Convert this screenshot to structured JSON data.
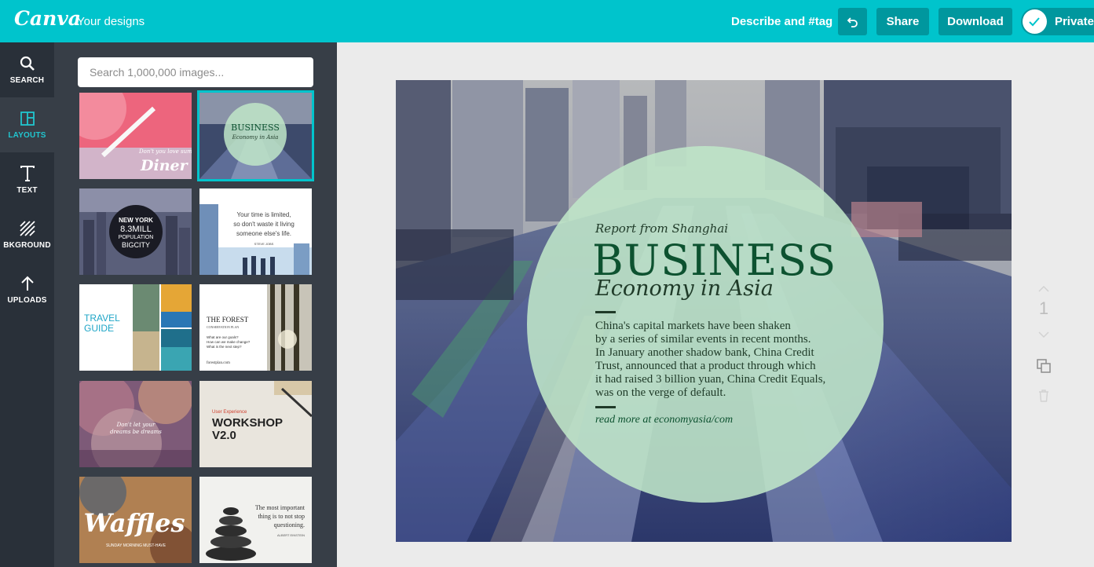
{
  "header": {
    "logo": "Canva",
    "your_designs": "Your designs",
    "describe": "Describe and #tag",
    "share": "Share",
    "download": "Download",
    "privacy": "Private",
    "accent_color": "#00c4cc"
  },
  "nav": {
    "search": "SEARCH",
    "layouts": "LAYOUTS",
    "text": "TEXT",
    "background": "BKGROUND",
    "uploads": "UPLOADS"
  },
  "panel": {
    "search_placeholder": "Search 1,000,000 images...",
    "thumbs": {
      "diner": {
        "text": "Diner",
        "small": "Don't you love summer?"
      },
      "business": {
        "t1": "BUSINESS",
        "t2": "Economy in Asia"
      },
      "newyork": {
        "l1": "NEW YORK",
        "l2": "8.3MILL",
        "l3": "POPULATION",
        "l4": "BIGCITY"
      },
      "quote": {
        "l1": "Your time is limited,",
        "l2": "so don't waste it living",
        "l3": "someone else's life.",
        "author": "STEVE JOBS"
      },
      "travel": {
        "l1": "TRAVEL",
        "l2": "GUIDE"
      },
      "forest": {
        "title": "THE FOREST",
        "sub": "CONSERVATION PLAN",
        "q1": "What are our goals?",
        "q2": "How can we make change?",
        "q3": "What is the next step?",
        "url": "forestplan.com"
      },
      "dream": {
        "l1": "Don't let your",
        "l2": "dreams be dreams"
      },
      "workshop": {
        "sub": "User Experience",
        "l1": "WORKSHOP",
        "l2": "V2.0"
      },
      "waffles": {
        "text": "Waffles",
        "sub": "SUNDAY MORNING MUST-HAVE"
      },
      "stones": {
        "l1": "The most important",
        "l2": "thing is to not stop",
        "l3": "questioning.",
        "author": "ALBERT EINSTEIN"
      }
    }
  },
  "design": {
    "kicker": "Report from Shanghai",
    "title": "BUSINESS",
    "subtitle": "Economy in Asia",
    "body_lines": [
      "China's capital markets have been shaken",
      "by a series of similar events in recent months.",
      "In January another shadow bank, China Credit",
      "Trust, announced that a product through which",
      "it had raised 3 billion yuan, China Credit Equals,",
      "was on the verge of default."
    ],
    "read_more": "read more at economyasia/com",
    "circle_color": "#bfe6c8"
  },
  "page": {
    "number": "1"
  }
}
